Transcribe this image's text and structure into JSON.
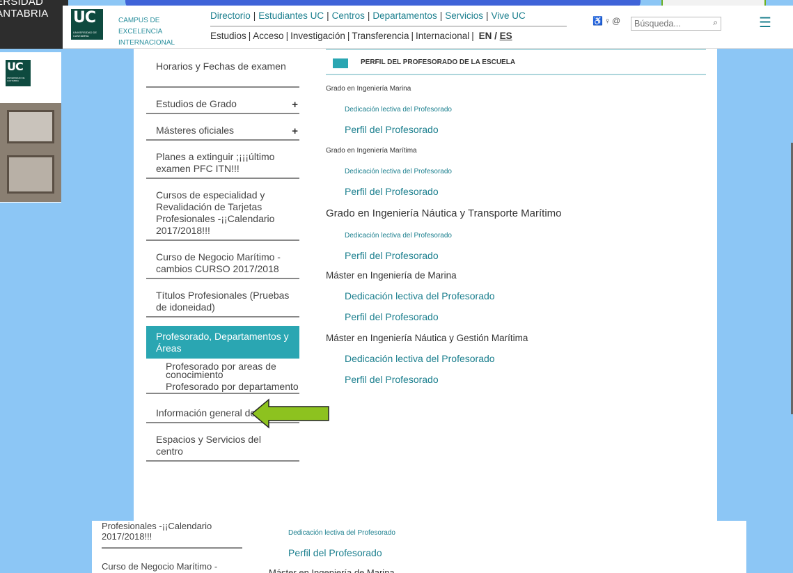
{
  "background": {
    "university_fragment": [
      "ERSIDAD",
      "ANTABRIA"
    ]
  },
  "header": {
    "logo_text": "UC",
    "logo_subtext": "UNIVERSIDAD DE CANTABRIA",
    "campus_lines": [
      "CAMPUS DE",
      "EXCELENCIA",
      "INTERNACIONAL"
    ],
    "nav_primary": [
      "Directorio",
      "Estudiantes UC",
      "Centros",
      "Departamentos",
      "Servicios",
      "Vive UC"
    ],
    "nav_secondary": [
      "Estudios",
      "Acceso",
      "Investigación",
      "Transferencia",
      "Internacional"
    ],
    "lang_en": "EN",
    "lang_es": "ES",
    "search_placeholder": "Búsqueda..."
  },
  "sidebar": {
    "items": [
      {
        "label": "Horarios y Fechas de examen",
        "has_plus": false
      },
      {
        "label": "Estudios de Grado",
        "has_plus": true
      },
      {
        "label": "Másteres oficiales",
        "has_plus": true
      },
      {
        "label": "Planes a extinguir ;¡¡¡último examen PFC ITN!!!",
        "has_plus": false
      },
      {
        "label": "Cursos de especialidad y Revalidación de Tarjetas Profesionales -¡¡Calendario 2017/2018!!!",
        "has_plus": false
      },
      {
        "label": "Curso de Negocio Marítimo - cambios CURSO 2017/2018",
        "has_plus": false
      },
      {
        "label": "Títulos Profesionales (Pruebas de idoneidad)",
        "has_plus": false
      }
    ],
    "active_item": "Profesorado, Departamentos y Áreas",
    "sub_items": [
      "Profesorado por areas de conocimiento",
      "Profesorado por departamento"
    ],
    "items_after": [
      "Información general del centro",
      "Espacios y Servicios del centro"
    ]
  },
  "content": {
    "section_title": "PERFIL DEL PROFESORADO DE LA ESCUELA",
    "rows": [
      {
        "text": "Grado en Ingeniería Marina",
        "kind": "heading-small"
      },
      {
        "text": "Dedicación lectiva del Profesorado",
        "kind": "link-small"
      },
      {
        "text": "Perfil del Profesorado",
        "kind": "link"
      },
      {
        "text": "Grado en Ingeniería Marítima",
        "kind": "heading-small"
      },
      {
        "text": "Dedicación lectiva del Profesorado",
        "kind": "link-small"
      },
      {
        "text": "Perfil del Profesorado",
        "kind": "link"
      },
      {
        "text": "Grado en Ingeniería Náutica y Transporte Marítimo",
        "kind": "heading-large"
      },
      {
        "text": "Dedicación lectiva del Profesorado",
        "kind": "link-small"
      },
      {
        "text": "Perfil del Profesorado",
        "kind": "link"
      },
      {
        "text": "Máster en Ingeniería de Marina",
        "kind": "heading"
      },
      {
        "text": "Dedicación lectiva del Profesorado",
        "kind": "link"
      },
      {
        "text": "Perfil del Profesorado",
        "kind": "link"
      },
      {
        "text": "Máster en Ingeniería Náutica y Gestión Marítima",
        "kind": "heading"
      },
      {
        "text": "Dedicación lectiva del Profesorado",
        "kind": "link"
      },
      {
        "text": "Perfil del Profesorado",
        "kind": "link"
      }
    ]
  },
  "bottom_fragment": {
    "left_text": "Profesionales -¡¡Calendario 2017/2018!!!",
    "left_text2": "Curso de Negocio Marítimo -",
    "right_link_small": "Dedicación lectiva del Profesorado",
    "right_link": "Perfil del Profesorado",
    "right_heading": "Máster en Ingeniería de Marina"
  },
  "colors": {
    "accent": "#2aa6b2",
    "link": "#1b7f8e",
    "brand_green": "#0e4a3f",
    "arrow_fill": "#8dc21f",
    "backdrop": "#8cc6f5"
  }
}
